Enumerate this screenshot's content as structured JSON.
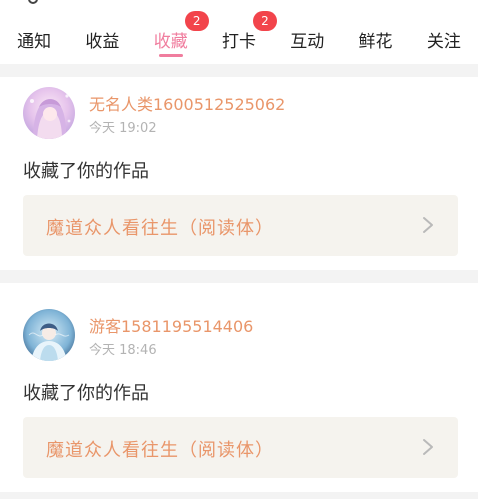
{
  "tabs": [
    {
      "label": "通知",
      "badge": ""
    },
    {
      "label": "收益",
      "badge": ""
    },
    {
      "label": "收藏",
      "badge": "2",
      "active": true
    },
    {
      "label": "打卡",
      "badge": "2"
    },
    {
      "label": "互动",
      "badge": ""
    },
    {
      "label": "鲜花",
      "badge": ""
    },
    {
      "label": "关注",
      "badge": ""
    }
  ],
  "notifications": [
    {
      "username": "无名人类1600512525062",
      "time": "今天 19:02",
      "action": "收藏了你的作品",
      "work_title": "魔道众人看往生（阅读体）"
    },
    {
      "username": "游客1581195514406",
      "time": "今天 18:46",
      "action": "收藏了你的作品",
      "work_title": "魔道众人看往生（阅读体）"
    }
  ],
  "colors": {
    "accent": "#f07d9e",
    "username": "#e9966a",
    "badge": "#f2444b",
    "work_bg": "#f5f3ee",
    "divider": "#f3f3f3"
  },
  "icons": {
    "chevron": "chevron-right-icon"
  }
}
